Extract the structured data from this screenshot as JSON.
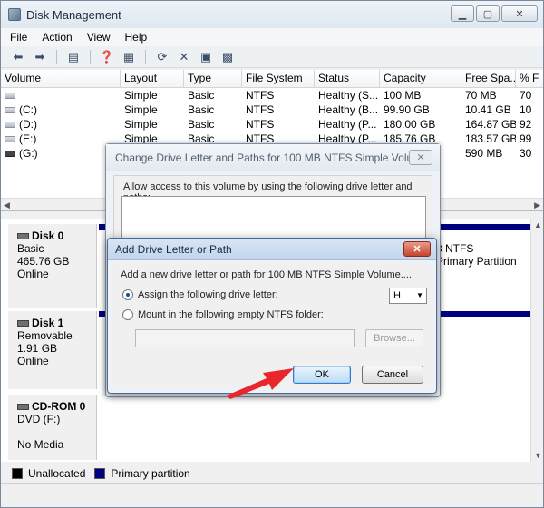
{
  "app": {
    "title": "Disk Management",
    "menu": [
      "File",
      "Action",
      "View",
      "Help"
    ]
  },
  "volumes": {
    "columns": [
      "Volume",
      "Layout",
      "Type",
      "File System",
      "Status",
      "Capacity",
      "Free Spa...",
      "% F"
    ],
    "rows": [
      {
        "volume": "",
        "layout": "Simple",
        "type": "Basic",
        "fs": "NTFS",
        "status": "Healthy (S...",
        "capacity": "100 MB",
        "free": "70 MB",
        "pct": "70"
      },
      {
        "volume": "(C:)",
        "layout": "Simple",
        "type": "Basic",
        "fs": "NTFS",
        "status": "Healthy (B...",
        "capacity": "99.90 GB",
        "free": "10.41 GB",
        "pct": "10"
      },
      {
        "volume": "(D:)",
        "layout": "Simple",
        "type": "Basic",
        "fs": "NTFS",
        "status": "Healthy (P...",
        "capacity": "180.00 GB",
        "free": "164.87 GB",
        "pct": "92"
      },
      {
        "volume": "(E:)",
        "layout": "Simple",
        "type": "Basic",
        "fs": "NTFS",
        "status": "Healthy (P...",
        "capacity": "185.76 GB",
        "free": "183.57 GB",
        "pct": "99"
      },
      {
        "volume": "(G:)",
        "layout": "",
        "type": "",
        "fs": "",
        "status": "",
        "capacity": "",
        "free": "590 MB",
        "pct": "30"
      }
    ]
  },
  "disks": [
    {
      "name": "Disk 0",
      "kind": "Basic",
      "size": "465.76 GB",
      "state": "Online",
      "partition_fs": "8 NTFS",
      "partition_status": "Primary Partition"
    },
    {
      "name": "Disk 1",
      "kind": "Removable",
      "size": "1.91 GB",
      "state": "Online"
    },
    {
      "name": "CD-ROM 0",
      "kind": "DVD (F:)",
      "size": "",
      "state": "No Media"
    }
  ],
  "legend": {
    "unallocated": "Unallocated",
    "primary": "Primary partition"
  },
  "dialog_paths": {
    "title": "Change Drive Letter and Paths for 100 MB NTFS Simple Volum...",
    "label": "Allow access to this volume by using the following drive letter and paths:"
  },
  "dialog_add": {
    "title": "Add Drive Letter or Path",
    "description": "Add a new drive letter or path for 100 MB NTFS Simple Volume....",
    "assign_label": "Assign the following drive letter:",
    "selected_letter": "H",
    "mount_label": "Mount in the following empty NTFS folder:",
    "browse_label": "Browse...",
    "ok_label": "OK",
    "cancel_label": "Cancel"
  },
  "colors": {
    "primary_partition": "#000080",
    "unallocated": "#000000",
    "annotation_arrow": "#e8262b"
  }
}
